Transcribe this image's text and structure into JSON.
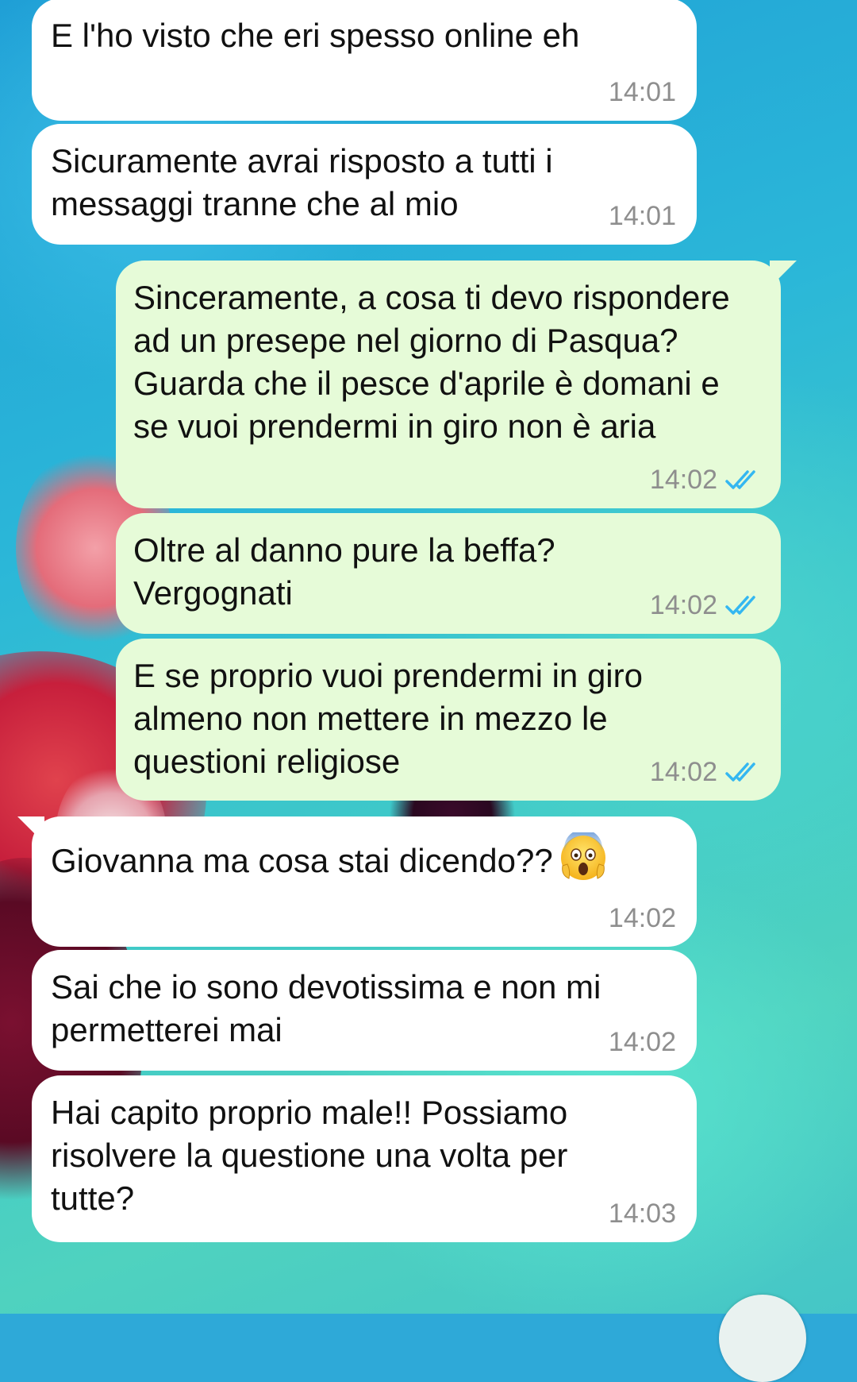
{
  "messages": [
    {
      "direction": "in",
      "text": "E l'ho visto che eri spesso online eh",
      "time": "14:01"
    },
    {
      "direction": "in",
      "text": "Sicuramente avrai risposto a tutti i messaggi tranne che al mio",
      "time": "14:01"
    },
    {
      "direction": "out",
      "text": "Sinceramente, a cosa ti devo rispondere ad un presepe nel giorno di Pasqua? Guarda che il pesce d'aprile è domani e se vuoi prendermi in giro non è aria",
      "time": "14:02",
      "status_icon": "double-check-read-icon"
    },
    {
      "direction": "out",
      "text": "Oltre al danno pure la beffa? Vergognati",
      "time": "14:02",
      "status_icon": "double-check-read-icon"
    },
    {
      "direction": "out",
      "text": "E se proprio vuoi prendermi in giro almeno non mettere in mezzo le questioni religiose",
      "time": "14:02",
      "status_icon": "double-check-read-icon"
    },
    {
      "direction": "in",
      "text": "Giovanna ma cosa stai dicendo??",
      "emoji": "screaming-face-emoji",
      "time": "14:02"
    },
    {
      "direction": "in",
      "text": "Sai che io sono devotissima e non mi permetterei mai",
      "time": "14:02"
    },
    {
      "direction": "in",
      "text": "Hai capito proprio male!! Possiamo risolvere la questione una volta per tutte?",
      "time": "14:03"
    }
  ],
  "colors": {
    "incoming_bubble": "#ffffff",
    "outgoing_bubble": "#e6fbd8",
    "timestamp": "#8e8e8e",
    "read_check": "#34b7f1"
  }
}
